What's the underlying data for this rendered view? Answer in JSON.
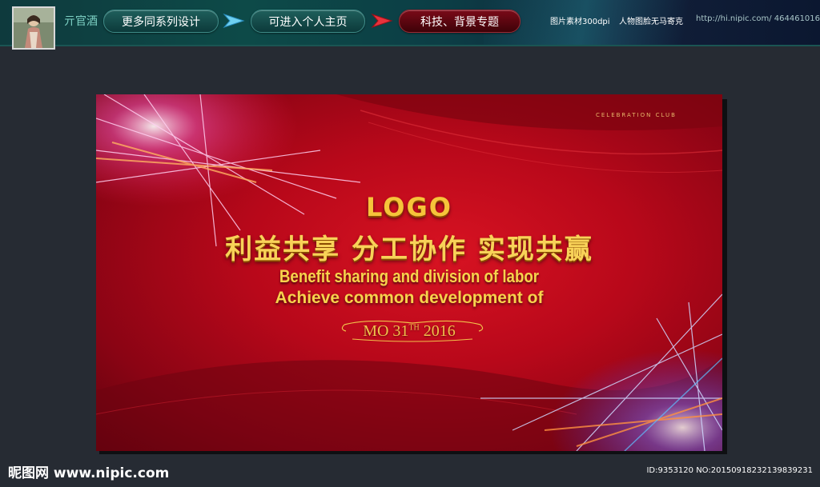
{
  "header": {
    "author_name": "亓官酒",
    "buttons": [
      {
        "label": "更多同系列设计"
      },
      {
        "label": "可进入个人主页"
      },
      {
        "label": "科技、背景专题"
      }
    ],
    "meta": {
      "resolution": "图片素材300dpi",
      "license": "人物图脸无马寄克",
      "url": "http://hi.nipic.com/ 464461016"
    },
    "colors": {
      "teal_pill": "#0c3a3a",
      "red_pill": "#3e0208"
    }
  },
  "poster": {
    "club": "CELEBRATION CLUB",
    "logo": "LOGO",
    "title_cn": "利益共享  分工协作  实现共赢",
    "subtitle_en_1": "Benefit sharing and division of labor",
    "subtitle_en_2": "Achieve common development of",
    "date": {
      "prefix": "MO 31",
      "suffix": "TH",
      "year": "2016"
    },
    "colors": {
      "background": "#b8081a",
      "text_gold": "#f7d34c"
    }
  },
  "footer": {
    "site_logo": "昵图网 www.nipic.com",
    "image_id": "ID:9353120 NO:20150918232139839231"
  }
}
